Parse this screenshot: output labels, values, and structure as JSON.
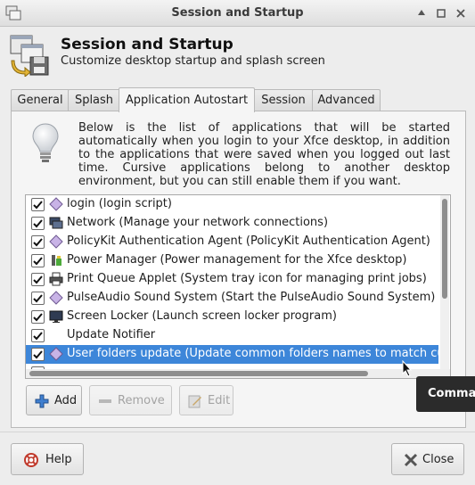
{
  "window": {
    "title": "Session and Startup",
    "controls": [
      "up-icon",
      "maximize-icon",
      "close-icon"
    ]
  },
  "header": {
    "title": "Session and Startup",
    "subtitle": "Customize desktop startup and splash screen"
  },
  "tabs": [
    {
      "label": "General",
      "active": false
    },
    {
      "label": "Splash",
      "active": false
    },
    {
      "label": "Application Autostart",
      "active": true
    },
    {
      "label": "Session",
      "active": false
    },
    {
      "label": "Advanced",
      "active": false
    }
  ],
  "description": "Below is the list of applications that will be started automatically when you login to your Xfce desktop, in addition to the applications that were saved when you logged out last time. Cursive applications belong to another desktop environment, but you can still enable them if you want.",
  "autostart": {
    "items": [
      {
        "label": "login (login script)",
        "checked": true,
        "icon": "diamond-icon"
      },
      {
        "label": "Network (Manage your network connections)",
        "checked": true,
        "icon": "network-icon"
      },
      {
        "label": "PolicyKit Authentication Agent (PolicyKit Authentication Agent)",
        "checked": true,
        "icon": "diamond-icon"
      },
      {
        "label": "Power Manager (Power management for the Xfce desktop)",
        "checked": true,
        "icon": "power-icon"
      },
      {
        "label": "Print Queue Applet (System tray icon for managing print jobs)",
        "checked": true,
        "icon": "printer-icon"
      },
      {
        "label": "PulseAudio Sound System (Start the PulseAudio Sound System)",
        "checked": true,
        "icon": "diamond-icon"
      },
      {
        "label": "Screen Locker (Launch screen locker program)",
        "checked": true,
        "icon": "screen-icon"
      },
      {
        "label": "Update Notifier",
        "checked": true,
        "icon": ""
      },
      {
        "label": "User folders update (Update common folders names to match cu",
        "checked": true,
        "icon": "diamond-icon",
        "selected": true
      }
    ]
  },
  "buttons": {
    "add": "Add",
    "remove": "Remove",
    "edit": "Edit",
    "help": "Help",
    "close": "Close"
  },
  "tooltip": "Comma",
  "colors": {
    "selection": "#3d86d9",
    "window_bg": "#ededed"
  }
}
